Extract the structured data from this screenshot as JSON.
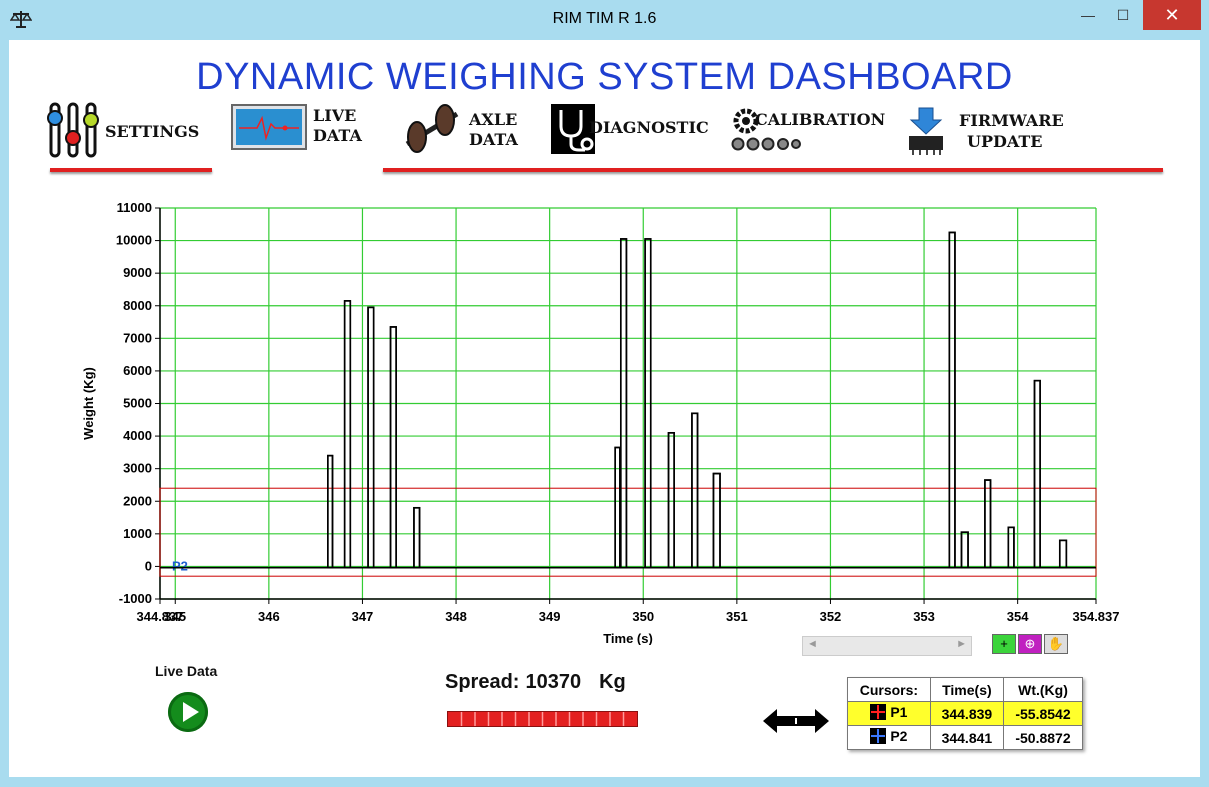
{
  "window": {
    "title": "RIM TIM R 1.6",
    "minimize": "—",
    "maximize": "☐",
    "close": "✕"
  },
  "header": {
    "title": "DYNAMIC WEIGHING SYSTEM DASHBOARD"
  },
  "nav": {
    "settings": "SETTINGS",
    "live_data": [
      "LIVE",
      "DATA"
    ],
    "axle_data": [
      "AXLE",
      "DATA"
    ],
    "diagnostic": "DIAGNOSTIC",
    "calibration": "CALIBRATION",
    "firmware_update": [
      "FIRMWARE",
      "UPDATE"
    ]
  },
  "chart_data": {
    "type": "line",
    "xlabel": "Time (s)",
    "ylabel": "Weight (Kg)",
    "xlim": [
      344.837,
      354.837
    ],
    "ylim": [
      -1000,
      11000
    ],
    "x_ticks": [
      "344.837",
      "345",
      "346",
      "347",
      "348",
      "349",
      "350",
      "351",
      "352",
      "353",
      "354",
      "354.837"
    ],
    "y_ticks": [
      -1000,
      0,
      1000,
      2000,
      3000,
      4000,
      5000,
      6000,
      7000,
      8000,
      9000,
      10000,
      11000
    ],
    "grid": true,
    "grid_color": "#33cc33",
    "line_color": "#000000",
    "pulses": [
      {
        "start": 346.63,
        "end": 346.68,
        "peak": 3400
      },
      {
        "start": 346.81,
        "end": 346.87,
        "peak": 8150
      },
      {
        "start": 347.06,
        "end": 347.12,
        "peak": 7950
      },
      {
        "start": 347.3,
        "end": 347.36,
        "peak": 7350
      },
      {
        "start": 347.55,
        "end": 347.61,
        "peak": 1800
      },
      {
        "start": 349.7,
        "end": 349.75,
        "peak": 3650
      },
      {
        "start": 349.76,
        "end": 349.82,
        "peak": 10050
      },
      {
        "start": 350.02,
        "end": 350.08,
        "peak": 10050
      },
      {
        "start": 350.27,
        "end": 350.33,
        "peak": 4100
      },
      {
        "start": 350.52,
        "end": 350.58,
        "peak": 4700
      },
      {
        "start": 350.75,
        "end": 350.82,
        "peak": 2850
      },
      {
        "start": 353.27,
        "end": 353.33,
        "peak": 10250
      },
      {
        "start": 353.4,
        "end": 353.47,
        "peak": 1050
      },
      {
        "start": 353.65,
        "end": 353.71,
        "peak": 2650
      },
      {
        "start": 353.9,
        "end": 353.96,
        "peak": 1200
      },
      {
        "start": 354.18,
        "end": 354.24,
        "peak": 5700
      },
      {
        "start": 354.45,
        "end": 354.52,
        "peak": 800
      }
    ],
    "baseline": -40,
    "cursor_box": {
      "x_from": 344.837,
      "x_to": 354.837,
      "y_from": -300,
      "y_to": 2400,
      "color": "#cc0000"
    },
    "cursor_label": "P2"
  },
  "graph_tools": {
    "scroll_left": "◄",
    "scroll_right": "►",
    "cursor_tool": "+",
    "zoom_tool": "⊕",
    "pan_tool": "✋"
  },
  "live_data": {
    "label": "Live Data"
  },
  "spread": {
    "label": "Spread:",
    "value": "10370",
    "unit": "Kg",
    "bar_fraction": 1.0
  },
  "cursors": {
    "headers": [
      "Cursors:",
      "Time(s)",
      "Wt.(Kg)"
    ],
    "rows": [
      {
        "name": "P1",
        "time": "344.839",
        "weight": "-55.8542",
        "color": "red"
      },
      {
        "name": "P2",
        "time": "344.841",
        "weight": "-50.8872",
        "color": "blue"
      }
    ]
  }
}
